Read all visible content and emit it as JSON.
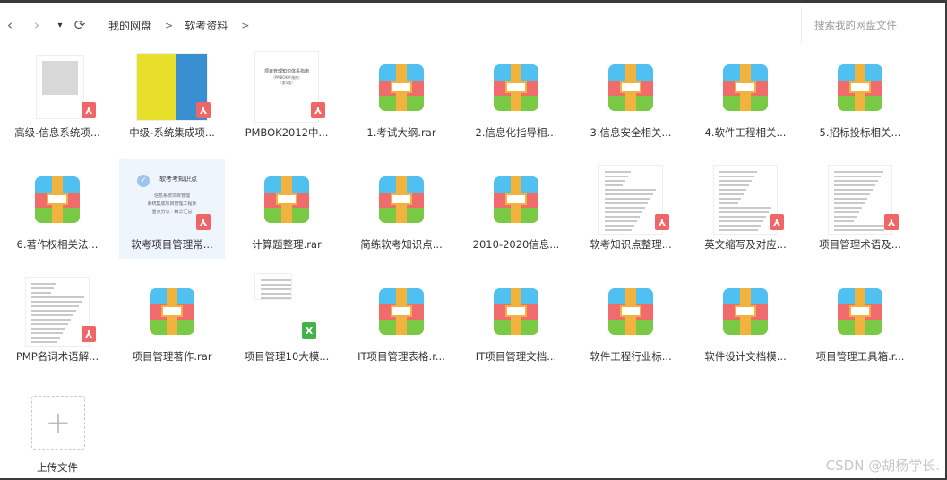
{
  "nav": {
    "back": "‹",
    "forward": "›",
    "dropdown": "▾",
    "refresh": "⟳"
  },
  "breadcrumb": {
    "items": [
      "我的网盘",
      "软考资料"
    ],
    "sep": ">"
  },
  "search": {
    "placeholder": "搜索我的网盘文件"
  },
  "files": [
    {
      "name": "高级-信息系统项...",
      "type": "pdf"
    },
    {
      "name": "中级-系统集成项...",
      "type": "pdf"
    },
    {
      "name": "PMBOK2012中...",
      "type": "pdf"
    },
    {
      "name": "1.考试大纲.rar",
      "type": "rar"
    },
    {
      "name": "2.信息化指导相...",
      "type": "rar"
    },
    {
      "name": "3.信息安全相关...",
      "type": "rar"
    },
    {
      "name": "4.软件工程相关...",
      "type": "rar"
    },
    {
      "name": "5.招标投标相关...",
      "type": "rar"
    },
    {
      "name": "6.著作权相关法...",
      "type": "rar"
    },
    {
      "name": "软考项目管理常...",
      "type": "pdf"
    },
    {
      "name": "计算题整理.rar",
      "type": "rar"
    },
    {
      "name": "简练软考知识点...",
      "type": "rar"
    },
    {
      "name": "2010-2020信息...",
      "type": "rar"
    },
    {
      "name": "软考知识点整理...",
      "type": "pdf"
    },
    {
      "name": "英文缩写及对应...",
      "type": "pdf"
    },
    {
      "name": "项目管理术语及...",
      "type": "pdf"
    },
    {
      "name": "PMP名词术语解...",
      "type": "pdf"
    },
    {
      "name": "项目管理著作.rar",
      "type": "rar"
    },
    {
      "name": "项目管理10大模...",
      "type": "xls"
    },
    {
      "name": "IT项目管理表格.r...",
      "type": "rar"
    },
    {
      "name": "IT项目管理文档...",
      "type": "rar"
    },
    {
      "name": "软件工程行业标...",
      "type": "rar"
    },
    {
      "name": "软件设计文档模...",
      "type": "rar"
    },
    {
      "name": "项目管理工具箱.r...",
      "type": "rar"
    }
  ],
  "selected_file_preview": {
    "title": "软考考知识点",
    "lines": [
      "信息系统项目管理",
      "系统集成项目管理工程师",
      "重点分享 · 精华汇总"
    ]
  },
  "book_covers": {
    "pmbok_title": "项目管理知识体系指南",
    "pmbok_subtitle": "（PMBOK®指南）",
    "pmbok_edition": "（第5版）"
  },
  "badges": {
    "pdf": "⅄",
    "xls": "X"
  },
  "upload": {
    "icon": "+",
    "label": "上传文件"
  },
  "watermark": "CSDN @胡杨学长."
}
